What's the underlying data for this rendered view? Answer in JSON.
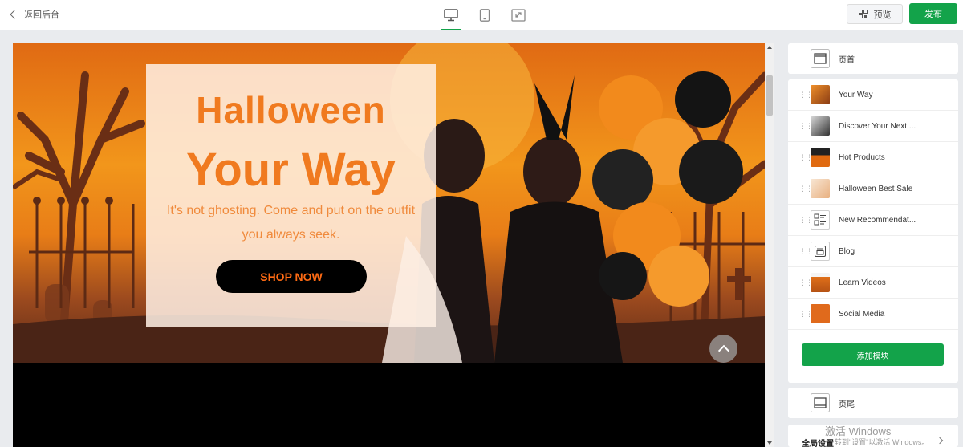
{
  "topbar": {
    "back_label": "返回后台",
    "preview_label": "预览",
    "publish_label": "发布",
    "devices": [
      "desktop-icon",
      "tablet-icon",
      "fullscreen-icon"
    ]
  },
  "hero": {
    "title_line1": "Halloween",
    "title_line2": "Your Way",
    "subtitle": "It's not ghosting. Come and put on the outfit you always seek.",
    "button_label": "SHOP NOW"
  },
  "panel": {
    "header_label": "页首",
    "modules": [
      {
        "label": "Your Way",
        "thumb": "#e07a20"
      },
      {
        "label": "Discover Your Next ...",
        "thumb": "#7a7a7a"
      },
      {
        "label": "Hot Products",
        "thumb": "#e06a10"
      },
      {
        "label": "Halloween Best Sale",
        "thumb": "#f5dcc4"
      },
      {
        "label": "New Recommendat...",
        "icon": "list-layout-icon"
      },
      {
        "label": "Blog",
        "icon": "blog-icon"
      },
      {
        "label": "Learn Videos",
        "thumb": "#e0701a"
      },
      {
        "label": "Social Media",
        "thumb": "#e06a1c"
      }
    ],
    "add_module_label": "添加模块",
    "footer_label": "页尾",
    "global_settings_label": "全局设置"
  },
  "watermark": {
    "line1": "激活 Windows",
    "line2": "转到\"设置\"以激活 Windows。"
  },
  "colors": {
    "accent_green": "#13a34a",
    "hero_orange": "#f07a1f"
  }
}
